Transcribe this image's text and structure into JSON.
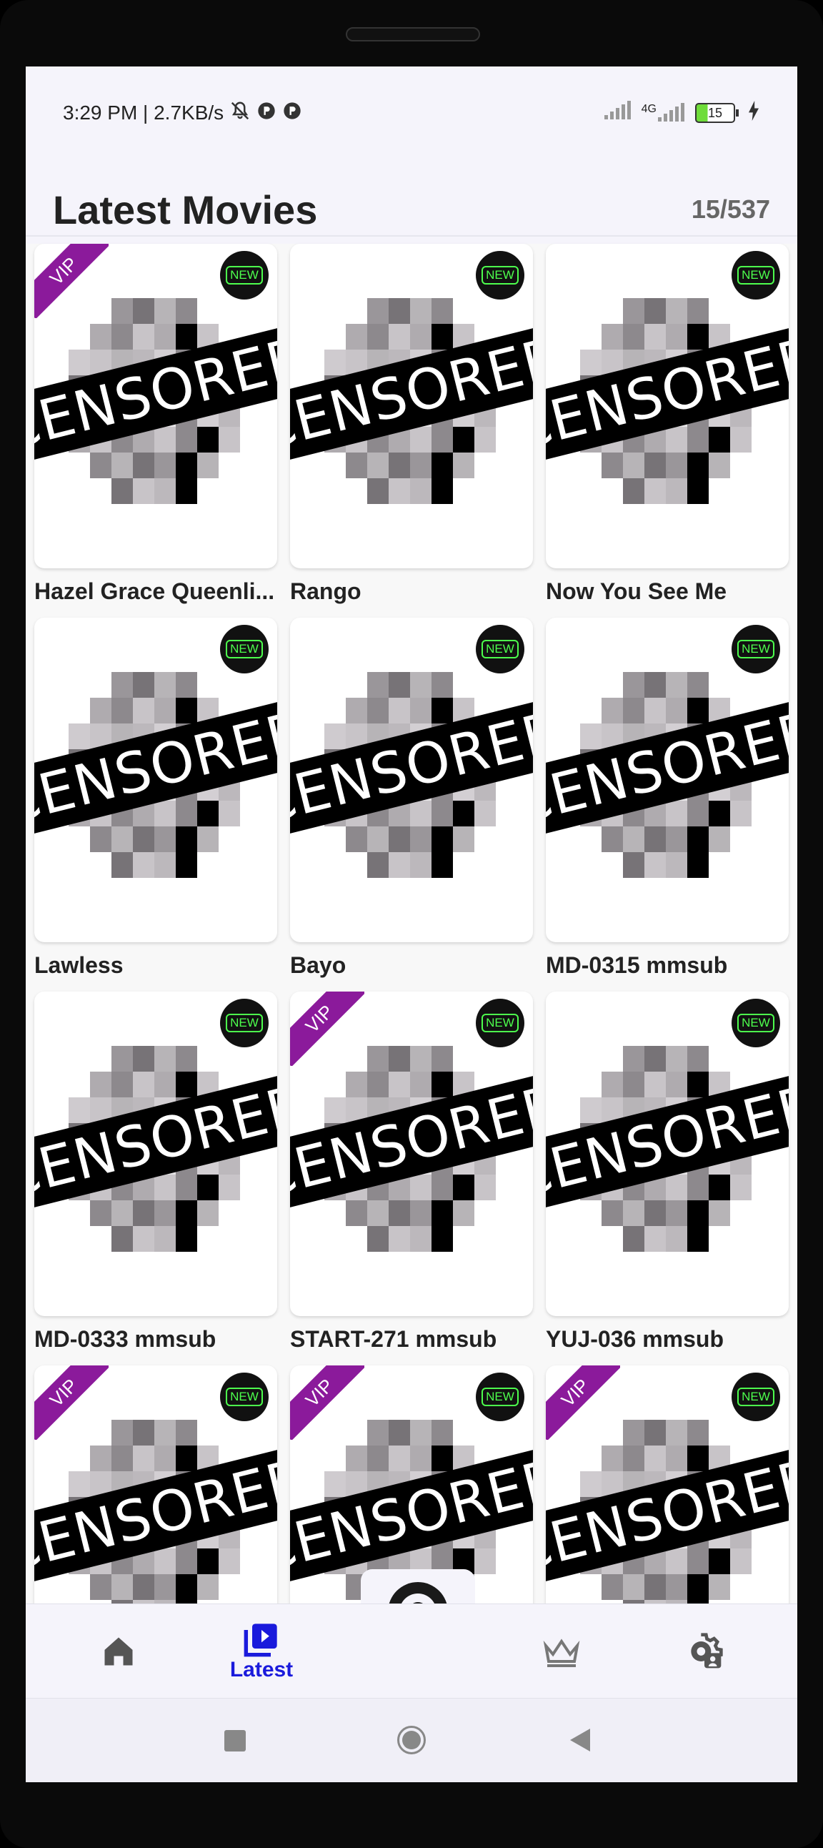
{
  "status": {
    "time_speed": "3:29 PM | 2.7KB/s",
    "network": "4G",
    "battery": "15"
  },
  "header": {
    "title": "Latest Movies",
    "counter": "15/537"
  },
  "poster": {
    "censor_label": "CENSORED",
    "vip_label": "VIP",
    "new_label": "NEW"
  },
  "movies": [
    {
      "title": "Hazel Grace Queenli...",
      "vip": true
    },
    {
      "title": "Rango",
      "vip": false
    },
    {
      "title": "Now You See Me",
      "vip": false
    },
    {
      "title": "Lawless",
      "vip": false
    },
    {
      "title": "Bayo",
      "vip": false
    },
    {
      "title": "MD-0315 mmsub",
      "vip": false
    },
    {
      "title": "MD-0333 mmsub",
      "vip": false
    },
    {
      "title": "START-271 mmsub",
      "vip": true
    },
    {
      "title": "YUJ-036 mmsub",
      "vip": false
    },
    {
      "title": "",
      "vip": true
    },
    {
      "title": "",
      "vip": true
    },
    {
      "title": "",
      "vip": true
    }
  ],
  "nav": {
    "items": [
      {
        "icon": "home-icon",
        "label": ""
      },
      {
        "icon": "video-library-icon",
        "label": "Latest"
      },
      {
        "icon": "award-ribbon-icon",
        "label": ""
      },
      {
        "icon": "crown-icon",
        "label": ""
      },
      {
        "icon": "settings-account-icon",
        "label": ""
      }
    ]
  },
  "colors": {
    "accent": "#1a1adc",
    "vip": "#8b1a9b",
    "new_green": "#4dff4d"
  }
}
